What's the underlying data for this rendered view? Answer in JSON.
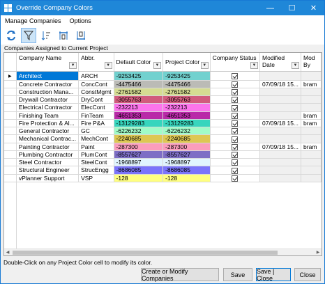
{
  "window": {
    "title": "Override Company Colors"
  },
  "menu": [
    "Manage Companies",
    "Options"
  ],
  "toolbar": {
    "buttons": [
      "refresh-icon",
      "filter-icon",
      "sort-icon",
      "expand-columns-icon",
      "collapse-columns-icon"
    ]
  },
  "section_label": "Companies Assigned to Current Project",
  "columns": [
    "Company Name",
    "Abbr.",
    "Default Color",
    "Project Color",
    "Company Status",
    "Modified Date",
    "Mod By"
  ],
  "rows": [
    {
      "name": "Architect",
      "abbr": "ARCH",
      "default": "-9253425",
      "default_color": "#72d1cf",
      "project": "-9253425",
      "project_color": "#72d1cf",
      "status": true,
      "date": "",
      "by": ""
    },
    {
      "name": "Concrete Contractor",
      "abbr": "ConcCont",
      "default": "-4475466",
      "default_color": "#bbbbb6",
      "project": "-4475466",
      "project_color": "#bbbbb6",
      "status": true,
      "date": "07/09/18 15...",
      "by": "bram"
    },
    {
      "name": "Construction Mana...",
      "abbr": "ConstMgmt",
      "default": "-2761582",
      "default_color": "#d5dc92",
      "project": "-2761582",
      "project_color": "#d5dc92",
      "status": true,
      "date": "",
      "by": ""
    },
    {
      "name": "Drywall Contractor",
      "abbr": "DryCont",
      "default": "-3055763",
      "default_color": "#d15b7d",
      "project": "-3055763",
      "project_color": "#d15b7d",
      "status": true,
      "date": "",
      "by": ""
    },
    {
      "name": "Electrical Contractor",
      "abbr": "ElecCont",
      "default": "-232213",
      "default_color": "#fc74ec",
      "project": "-232213",
      "project_color": "#fc74ec",
      "status": true,
      "date": "",
      "by": ""
    },
    {
      "name": "Finishing Team",
      "abbr": "FinTeam",
      "default": "-4651353",
      "default_color": "#b92aa8",
      "project": "-4651353",
      "project_color": "#b92aa8",
      "status": true,
      "date": "",
      "by": "bram"
    },
    {
      "name": "Fire Protection & Al...",
      "abbr": "Fire P&A",
      "default": "-13129283",
      "default_color": "#37d5bd",
      "project": "-13129283",
      "project_color": "#37d5bd",
      "status": true,
      "date": "07/09/18 15...",
      "by": "bram"
    },
    {
      "name": "General Contractor",
      "abbr": "GC",
      "default": "-6226232",
      "default_color": "#a0fbc8",
      "project": "-6226232",
      "project_color": "#a0fbc8",
      "status": true,
      "date": "",
      "by": ""
    },
    {
      "name": "Mechanical Contrac...",
      "abbr": "MechCont",
      "default": "-2240685",
      "default_color": "#ddc753",
      "project": "-2240685",
      "project_color": "#ddc753",
      "status": true,
      "date": "",
      "by": ""
    },
    {
      "name": "Painting Contractor",
      "abbr": "Paint",
      "default": "-287300",
      "default_color": "#fb9dbc",
      "project": "-287300",
      "project_color": "#fb9dbc",
      "status": true,
      "date": "07/09/18 15...",
      "by": "bram"
    },
    {
      "name": "Plumbing Contractor",
      "abbr": "PlumCont",
      "default": "-8557627",
      "default_color": "#7d6ec5",
      "project": "-8557627",
      "project_color": "#7d6ec5",
      "status": true,
      "date": "",
      "by": ""
    },
    {
      "name": "Steel Contractor",
      "abbr": "SteelCont",
      "default": "-1968897",
      "default_color": "#e1f5ff",
      "project": "-1968897",
      "project_color": "#e1f5ff",
      "status": true,
      "date": "",
      "by": ""
    },
    {
      "name": "Structural Engineer",
      "abbr": "StrucEngg",
      "default": "-8686085",
      "default_color": "#7b74fb",
      "project": "-8686085",
      "project_color": "#7b74fb",
      "status": true,
      "date": "",
      "by": ""
    },
    {
      "name": "vPlanner Support",
      "abbr": "VSP",
      "default": "-128",
      "default_color": "#ffff80",
      "project": "-128",
      "project_color": "#ffff80",
      "status": true,
      "date": "",
      "by": ""
    }
  ],
  "status_text": "Double-Click on any Project Color cell to modify its color.",
  "footer": {
    "create_label": "Create or Modify Companies",
    "save_label": "Save",
    "save_close_label": "Save | Close",
    "close_label": "Close"
  }
}
